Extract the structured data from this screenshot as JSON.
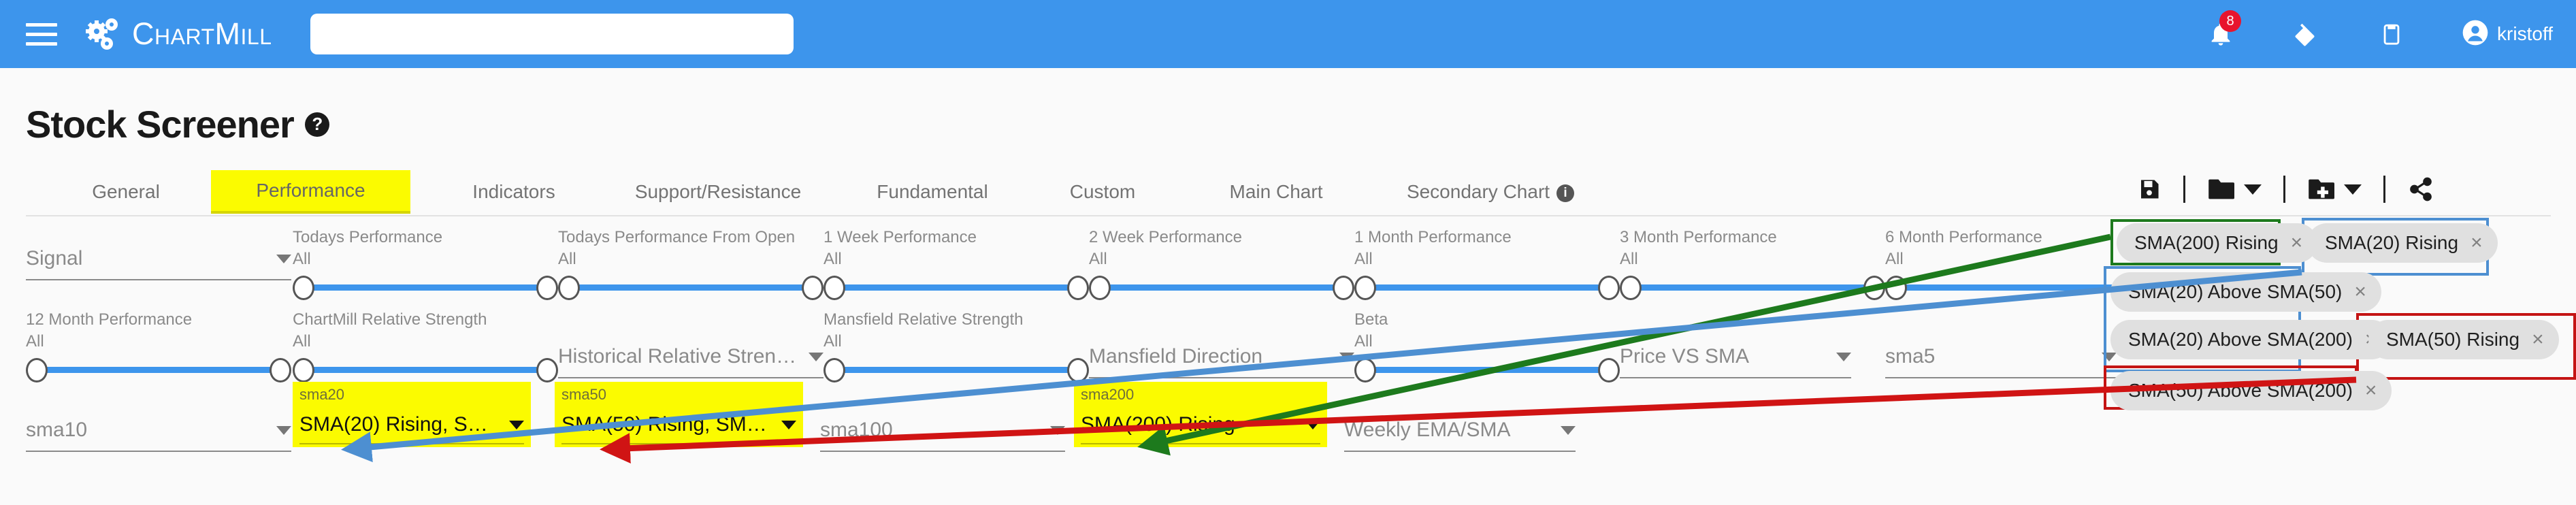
{
  "navbar": {
    "menu_icon": "hamburger-icon",
    "brand": "ChartMill",
    "search_placeholder": "",
    "search_value": "",
    "notifications_icon": "bell-icon",
    "notifications_count": "8",
    "theme_icon": "paint-icon",
    "clipboard_icon": "clipboard-icon",
    "user_icon": "user-avatar-icon",
    "user_name": "kristoff",
    "brand_color": "#3d95ec",
    "badge_color": "#e8142d"
  },
  "page": {
    "title": "Stock Screener",
    "help_icon": "question-mark-icon"
  },
  "tabs": [
    {
      "label": "General",
      "active": false
    },
    {
      "label": "Performance",
      "active": true
    },
    {
      "label": "Indicators",
      "active": false
    },
    {
      "label": "Support/Resistance",
      "active": false
    },
    {
      "label": "Fundamental",
      "active": false
    },
    {
      "label": "Custom",
      "active": false
    },
    {
      "label": "Main Chart",
      "active": false
    },
    {
      "label": "Secondary Chart",
      "active": false,
      "info": true
    }
  ],
  "toolbar": [
    {
      "name": "save-button",
      "icon": "floppy-disk-icon",
      "caret": false
    },
    {
      "name": "open-folder-button",
      "icon": "folder-icon",
      "caret": true
    },
    {
      "name": "new-folder-button",
      "icon": "folder-plus-icon",
      "caret": true
    },
    {
      "name": "share-button",
      "icon": "share-icon",
      "caret": false
    }
  ],
  "filters": {
    "signal": {
      "label": "Signal",
      "value": "Signal"
    },
    "sliders_row1": [
      {
        "label": "Todays Performance",
        "value": "All"
      },
      {
        "label": "Todays Performance From Open",
        "value": "All"
      },
      {
        "label": "1 Week Performance",
        "value": "All"
      },
      {
        "label": "2 Week Performance",
        "value": "All"
      },
      {
        "label": "1 Month Performance",
        "value": "All"
      },
      {
        "label": "3 Month Performance",
        "value": "All"
      },
      {
        "label": "6 Month Performance",
        "value": "All"
      }
    ],
    "sliders_row2": [
      {
        "label": "12 Month Performance",
        "value": "All"
      },
      {
        "label": "ChartMill Relative Strength",
        "value": "All"
      },
      {
        "label": "Mansfield Relative Strength",
        "value": "All"
      },
      {
        "label": "Beta",
        "value": "All"
      }
    ],
    "hist_rel_strength": {
      "value": "Historical Relative Stren…"
    },
    "mansfield_direction": {
      "value": "Mansfield Direction"
    },
    "price_vs_sma": {
      "value": "Price VS SMA"
    },
    "sma5": {
      "value": "sma5"
    },
    "sma10": {
      "value": "sma10"
    },
    "sma20": {
      "caption": "sma20",
      "value": "SMA(20) Rising, SMA(2…"
    },
    "sma50": {
      "caption": "sma50",
      "value": "SMA(50) Rising, SMA(5…"
    },
    "sma100": {
      "value": "sma100"
    },
    "sma200": {
      "caption": "sma200",
      "value": "SMA(200) Rising"
    },
    "weekly_ema_sma": {
      "value": "Weekly EMA/SMA"
    }
  },
  "chips": [
    {
      "label": "SMA(200) Rising",
      "close": "×"
    },
    {
      "label": "SMA(20) Rising",
      "close": "×"
    },
    {
      "label": "SMA(20) Above SMA(50)",
      "close": "×"
    },
    {
      "label": "SMA(20) Above SMA(200)",
      "close": "×"
    },
    {
      "label": "SMA(50) Rising",
      "close": "×"
    },
    {
      "label": "SMA(50) Above SMA(200)",
      "close": "×"
    }
  ],
  "annotations": {
    "green": {
      "color": "#1d7a1d",
      "from_chip": "SMA(200) Rising",
      "to_field": "sma200"
    },
    "blue": {
      "color": "#4d8fd1",
      "from_chips": [
        "SMA(20) Rising",
        "SMA(20) Above SMA(50)",
        "SMA(20) Above SMA(200)"
      ],
      "to_field": "sma20"
    },
    "red": {
      "color": "#d01414",
      "from_chips": [
        "SMA(50) Rising",
        "SMA(50) Above SMA(200)"
      ],
      "to_field": "sma50"
    }
  },
  "colors": {
    "highlight_yellow": "#fbfb00",
    "slider_blue": "#3d95ec",
    "chip_gray": "#e0e0e0"
  }
}
